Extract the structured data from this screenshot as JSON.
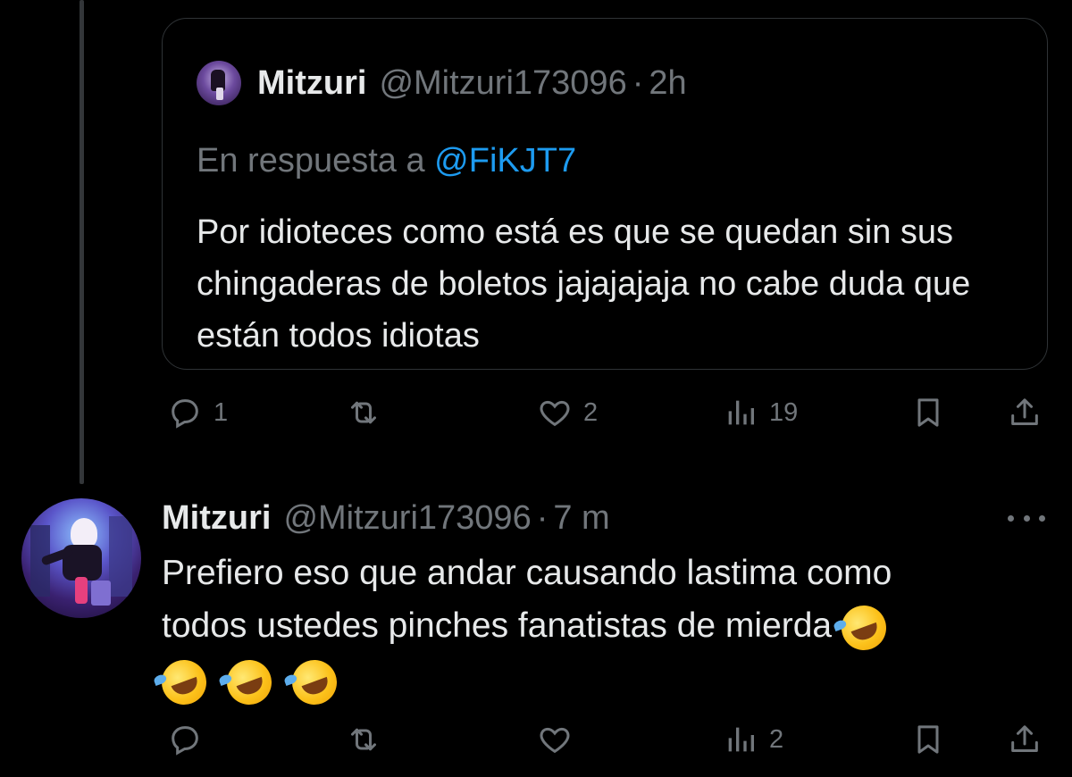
{
  "parent_tweet": {
    "author_name": "Mitzuri",
    "author_handle": "@Mitzuri173096",
    "separator": "·",
    "time": "2h",
    "reply_prefix": "En respuesta a",
    "reply_mention": "@FiKJT7",
    "text": "Por idioteces como está es que se quedan sin sus chingaderas de boletos jajajajaja no cabe duda que están todos idiotas",
    "actions": {
      "reply_count": "1",
      "retweet_count": "",
      "like_count": "2",
      "view_count": "19"
    }
  },
  "reply_tweet": {
    "author_name": "Mitzuri",
    "author_handle": "@Mitzuri173096",
    "separator": "·",
    "time": "7 m",
    "text_line1": "Prefiero eso que andar causando lastima como",
    "text_line2": "todos ustedes pinches fanatistas de mierda",
    "emoji_name": "rolling-on-the-floor-laughing",
    "emoji_count_line2": 1,
    "emoji_count_line3": 3,
    "actions": {
      "reply_count": "",
      "retweet_count": "",
      "like_count": "",
      "view_count": "2"
    }
  },
  "icons": {
    "reply": "comment-bubble-icon",
    "retweet": "retweet-icon",
    "like": "heart-icon",
    "views": "analytics-bars-icon",
    "bookmark": "bookmark-icon",
    "share": "share-icon",
    "more": "more-dots-icon"
  },
  "colors": {
    "background": "#000000",
    "text": "#e7e9ea",
    "muted": "#71767b",
    "link": "#1d9bf0",
    "border": "#2f3336"
  }
}
